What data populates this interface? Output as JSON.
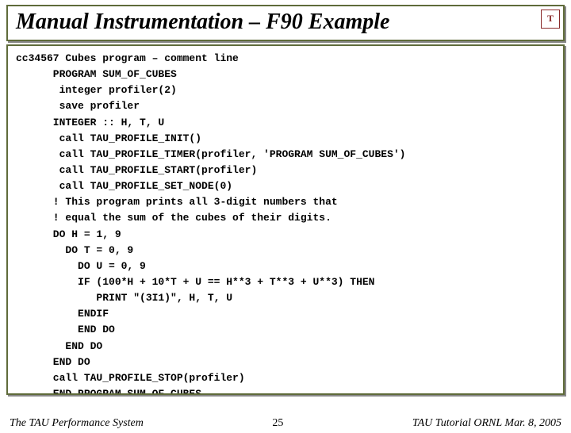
{
  "title": "Manual Instrumentation – F90 Example",
  "logo": "T",
  "code": {
    "l0": "cc34567 Cubes program – comment line",
    "l1": "      PROGRAM SUM_OF_CUBES",
    "l2": "       integer profiler(2)",
    "l3": "       save profiler",
    "l4": "      INTEGER :: H, T, U",
    "l5": "       call TAU_PROFILE_INIT()",
    "l6": "       call TAU_PROFILE_TIMER(profiler, 'PROGRAM SUM_OF_CUBES')",
    "l7": "       call TAU_PROFILE_START(profiler)",
    "l8": "       call TAU_PROFILE_SET_NODE(0)",
    "l9": "      ! This program prints all 3-digit numbers that",
    "l10": "      ! equal the sum of the cubes of their digits.",
    "l11": "      DO H = 1, 9",
    "l12": "        DO T = 0, 9",
    "l13": "          DO U = 0, 9",
    "l14": "          IF (100*H + 10*T + U == H**3 + T**3 + U**3) THEN",
    "l15": "             PRINT \"(3I1)\", H, T, U",
    "l16": "          ENDIF",
    "l17": "          END DO",
    "l18": "        END DO",
    "l19": "      END DO",
    "l20": "      call TAU_PROFILE_STOP(profiler)",
    "l21": "      END PROGRAM SUM_OF_CUBES"
  },
  "footer": {
    "left": "The TAU Performance System",
    "center": "25",
    "right": "TAU Tutorial ORNL Mar. 8, 2005"
  }
}
